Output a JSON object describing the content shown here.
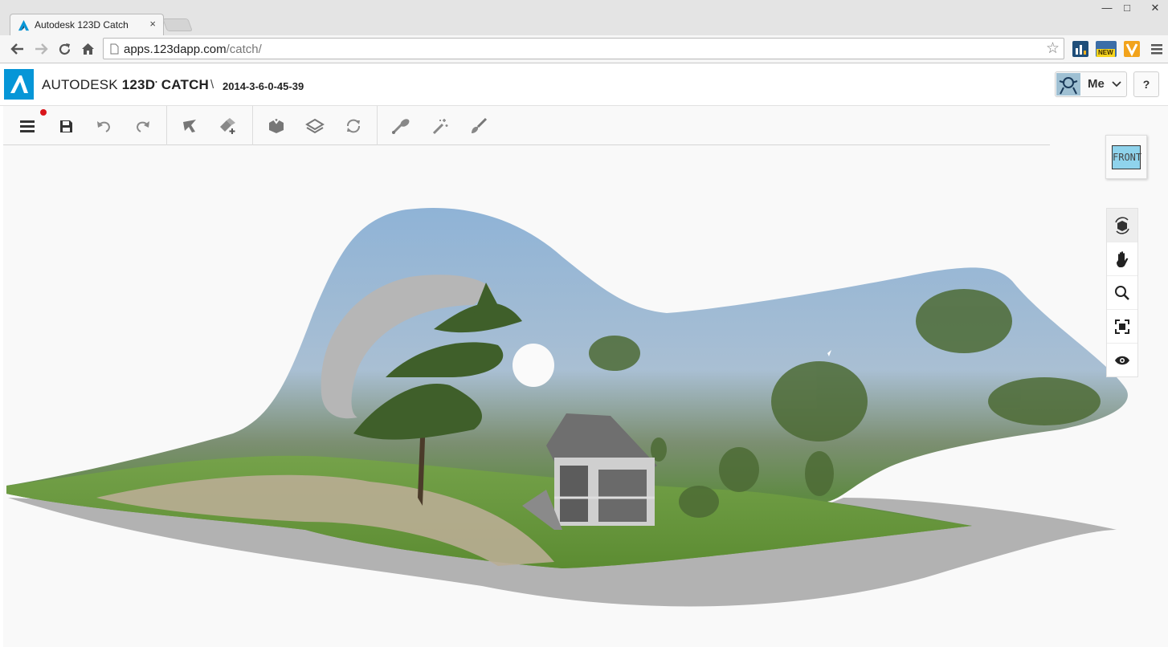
{
  "browser": {
    "tab_title": "Autodesk 123D Catch",
    "tab_close": "×",
    "url_host": "apps.123dapp.com",
    "url_path": "/catch/",
    "window_controls": {
      "minimize": "—",
      "maximize": "□",
      "close": "✕"
    },
    "extensions": [
      "chart-extension-icon",
      "new-badge-extension-icon",
      "v-extension-icon"
    ],
    "ext_badge": "NEW"
  },
  "app": {
    "brand_prefix": "AUTODESK",
    "brand_product": "123D",
    "brand_suffix": "CATCH",
    "separator": "\\",
    "project_name": "2014-3-6-0-45-39",
    "user_label": "Me",
    "help_label": "?",
    "accent_color": "#0696d7"
  },
  "toolbar": {
    "groups": [
      [
        "menu-icon",
        "save-icon",
        "undo-icon",
        "redo-icon"
      ],
      [
        "select-icon",
        "lasso-add-icon"
      ],
      [
        "solid-icon",
        "layers-icon",
        "refresh-icon"
      ],
      [
        "measure-icon",
        "magic-wand-icon",
        "paint-brush-icon"
      ]
    ],
    "unsaved_indicator_color": "#d9151b"
  },
  "viewcube": {
    "face_label": "FRONT",
    "face_color": "#8fd3ec"
  },
  "navigation": [
    "orbit-icon",
    "pan-icon",
    "zoom-icon",
    "fit-icon",
    "look-icon"
  ]
}
